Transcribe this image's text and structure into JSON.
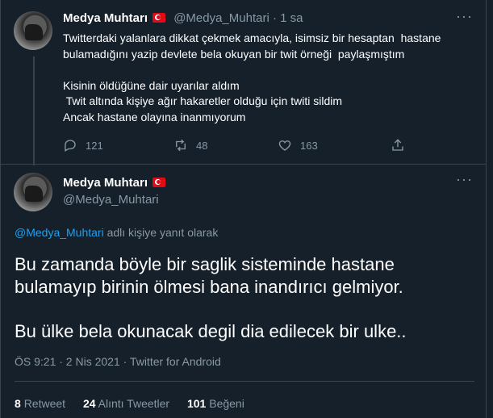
{
  "tweet1": {
    "name": "Medya Muhtarı",
    "handle": "@Medya_Muhtari",
    "separator": "·",
    "time": "1 sa",
    "lines": [
      "Twitterdaki yalanlara dikkat çekmek amacıyla, isimsiz bir hesaptan  hastane",
      "bulamadığını yazip devlete bela okuyan bir twit örneği  paylaşmıştım",
      "",
      "Kisinin öldüğüne dair uyarılar aldım",
      " Twit altında kişiye ağır hakaretler olduğu için twiti sildim",
      "Ancak hastane olayına inanmıyorum"
    ],
    "actions": {
      "reply_count": "121",
      "retweet_count": "48",
      "like_count": "163"
    }
  },
  "tweet2": {
    "name": "Medya Muhtarı",
    "handle": "@Medya_Muhtari",
    "reply_to_handle": "@Medya_Muhtari",
    "reply_to_suffix": " adlı kişiye yanıt olarak",
    "para1": "Bu zamanda böyle bir saglik sisteminde hastane bulamayıp birinin ölmesi bana inandırıcı gelmiyor.",
    "para2": "Bu ülke bela okunacak degil dia edilecek bir ulke..",
    "meta": "ÖS 9:21 · 2 Nis 2021 · Twitter for Android",
    "stats": {
      "retweets": "8",
      "retweets_label": "Retweet",
      "quotes": "24",
      "quotes_label": "Alıntı Tweetler",
      "likes": "101",
      "likes_label": "Beğeni"
    }
  },
  "colors": {
    "background": "#15202b",
    "muted": "#8899a6",
    "link": "#1da1f2",
    "border": "#38444d"
  }
}
